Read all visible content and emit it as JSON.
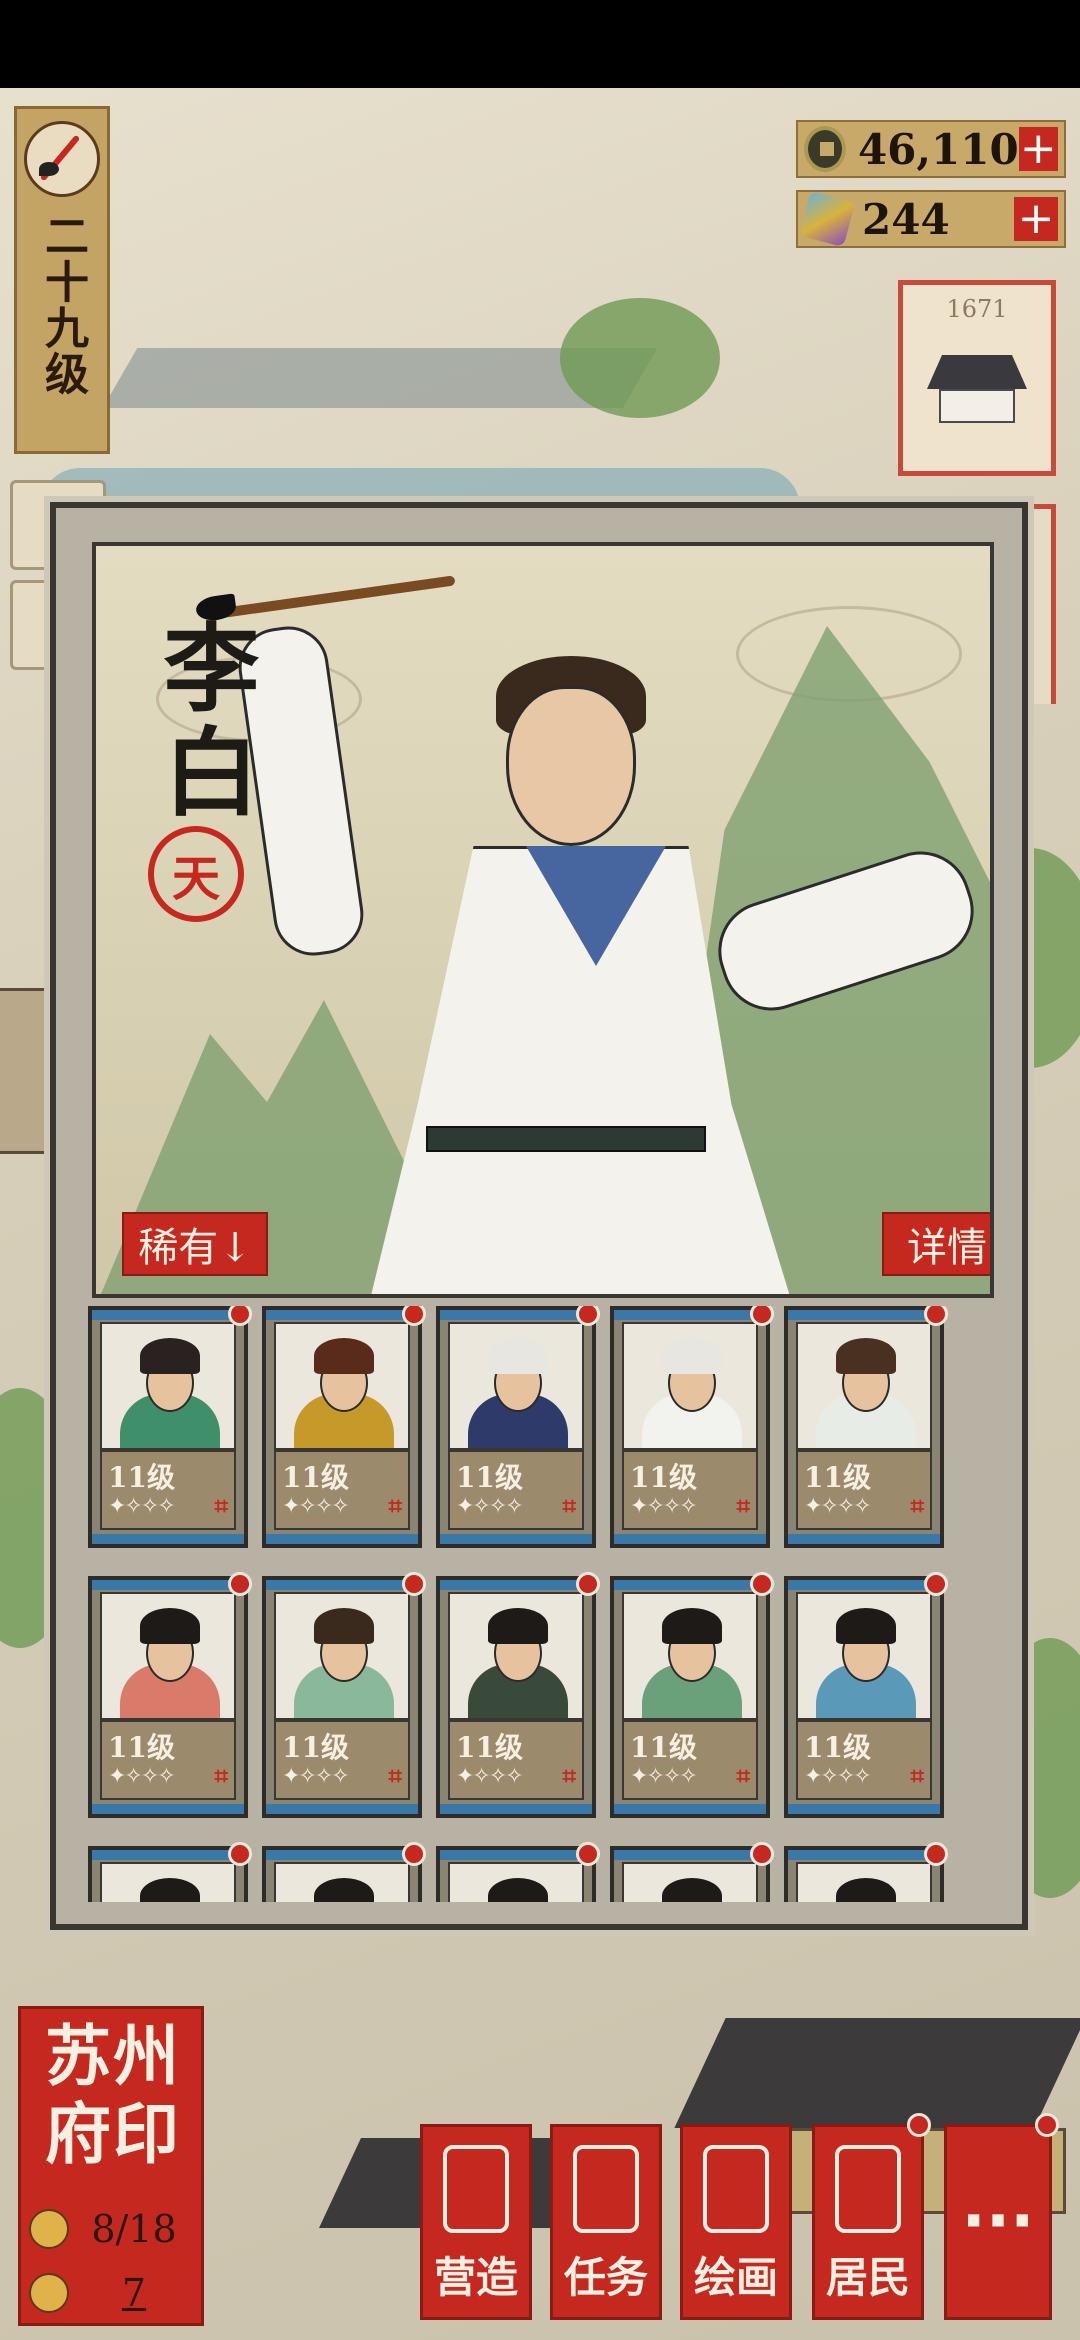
{
  "level": {
    "text": "二十九级"
  },
  "currency": {
    "coins": "46,110",
    "gems": "244",
    "plus": "+"
  },
  "building": {
    "number": "1671"
  },
  "hero": {
    "name": "李白",
    "seal": "天",
    "rarity_btn": "稀有↓",
    "detail_btn": "详情"
  },
  "cards": [
    {
      "level": "11级",
      "stars": "✦✧✧✧",
      "mark": "⌗",
      "robe": "#3f8f6a",
      "hair": "#2a2220"
    },
    {
      "level": "11级",
      "stars": "✦✧✧✧",
      "mark": "⌗",
      "robe": "#c59a2a",
      "hair": "#5a2a1a"
    },
    {
      "level": "11级",
      "stars": "✦✧✧✧",
      "mark": "⌗",
      "robe": "#2e3a6a",
      "hair": "#e8e6e0"
    },
    {
      "level": "11级",
      "stars": "✦✧✧✧",
      "mark": "⌗",
      "robe": "#f2f2ee",
      "hair": "#e8e6e0"
    },
    {
      "level": "11级",
      "stars": "✦✧✧✧",
      "mark": "⌗",
      "robe": "#e8ece6",
      "hair": "#4a3020"
    },
    {
      "level": "11级",
      "stars": "✦✧✧✧",
      "mark": "⌗",
      "robe": "#d97a6a",
      "hair": "#1e1a18"
    },
    {
      "level": "11级",
      "stars": "✦✧✧✧",
      "mark": "⌗",
      "robe": "#8ab89a",
      "hair": "#3a2a1e"
    },
    {
      "level": "11级",
      "stars": "✦✧✧✧",
      "mark": "⌗",
      "robe": "#3a4a3a",
      "hair": "#1e1a18"
    },
    {
      "level": "11级",
      "stars": "✦✧✧✧",
      "mark": "⌗",
      "robe": "#6aa07a",
      "hair": "#1e1a18"
    },
    {
      "level": "11级",
      "stars": "✦✧✧✧",
      "mark": "⌗",
      "robe": "#5a9ab8",
      "hair": "#1e1a18"
    },
    {
      "level": "",
      "stars": "",
      "mark": "",
      "robe": "#5a4a3a",
      "hair": "#1e1a18"
    },
    {
      "level": "",
      "stars": "",
      "mark": "",
      "robe": "#2a2a2a",
      "hair": "#1e1a18"
    },
    {
      "level": "",
      "stars": "",
      "mark": "",
      "robe": "#2a2a2a",
      "hair": "#1e1a18"
    },
    {
      "level": "",
      "stars": "",
      "mark": "",
      "robe": "#2a2a2a",
      "hair": "#1e1a18"
    },
    {
      "level": "",
      "stars": "",
      "mark": "",
      "robe": "#2a2a2a",
      "hair": "#1e1a18"
    }
  ],
  "city_seal": {
    "title": "苏州府印",
    "population": "8/18",
    "count": "7"
  },
  "nav": {
    "build": "营造",
    "task": "任务",
    "paint": "绘画",
    "residents": "居民",
    "more": "···"
  },
  "colors": {
    "accent_red": "#c5281f",
    "strip_blue": "#3a78a8"
  }
}
